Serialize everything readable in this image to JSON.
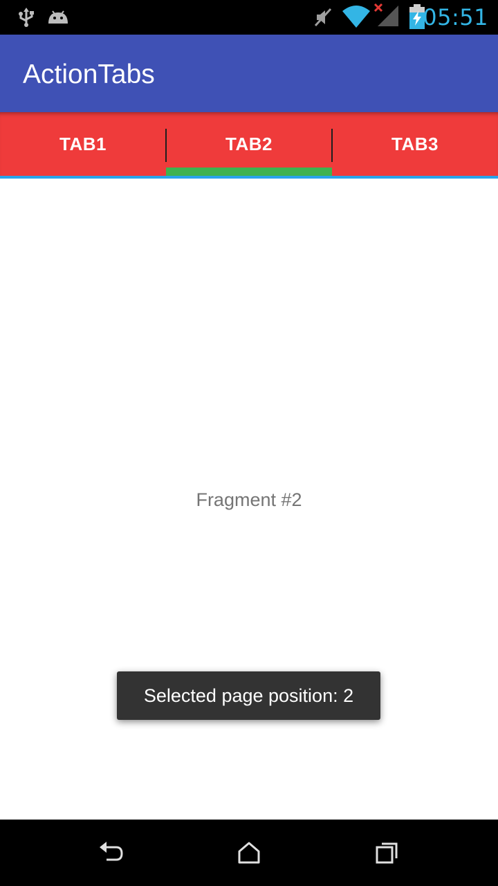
{
  "status_bar": {
    "time": "05:51",
    "icons": [
      "usb-icon",
      "android-debug-icon",
      "mute-icon",
      "wifi-icon",
      "no-signal-icon",
      "battery-charging-icon"
    ]
  },
  "app_bar": {
    "title": "ActionTabs",
    "color": "#3f51b5"
  },
  "tabs": {
    "selected_index": 1,
    "background_color": "#ef3b3b",
    "indicator_color": "#3fb24f",
    "items": [
      {
        "label": "TAB1"
      },
      {
        "label": "TAB2"
      },
      {
        "label": "TAB3"
      }
    ]
  },
  "content": {
    "fragment_label": "Fragment #2"
  },
  "toast": {
    "message": "Selected page position: 2"
  },
  "nav_bar": {
    "buttons": [
      "back-icon",
      "home-icon",
      "recents-icon"
    ]
  }
}
